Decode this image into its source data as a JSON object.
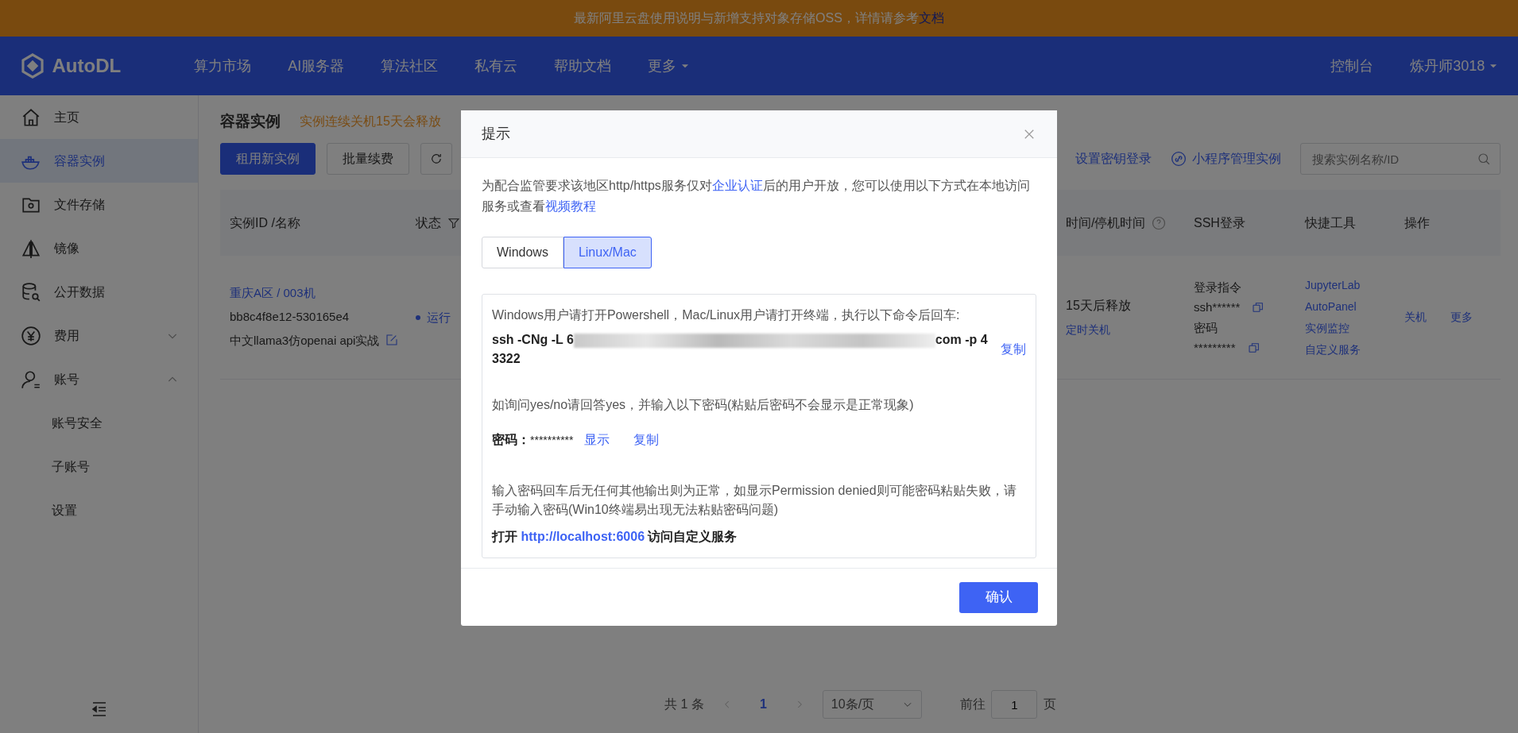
{
  "banner": {
    "text": "最新阿里云盘使用说明与新增支持对象存储OSS，详情请参考",
    "link": "文档"
  },
  "navbar": {
    "brand": "AutoDL",
    "items": [
      {
        "label": "算力市场",
        "kind": "link"
      },
      {
        "label": "AI服务器",
        "kind": "link"
      },
      {
        "label": "算法社区",
        "kind": "link"
      },
      {
        "label": "私有云",
        "kind": "link"
      },
      {
        "label": "帮助文档",
        "kind": "link"
      },
      {
        "label": "更多",
        "kind": "dropdown"
      }
    ],
    "right": [
      {
        "label": "控制台",
        "kind": "link"
      },
      {
        "label": "炼丹师3018",
        "kind": "dropdown"
      }
    ]
  },
  "sidebar": {
    "items": [
      {
        "label": "主页",
        "selected": false
      },
      {
        "label": "容器实例",
        "selected": true
      },
      {
        "label": "文件存储",
        "selected": false
      },
      {
        "label": "镜像",
        "selected": false
      },
      {
        "label": "公开数据",
        "selected": false
      },
      {
        "label": "费用",
        "selected": false,
        "expanded": false
      },
      {
        "label": "账号",
        "selected": false,
        "expanded": true,
        "children": [
          {
            "label": "账号安全",
            "selected": false
          },
          {
            "label": "子账号",
            "selected": false
          },
          {
            "label": "设置",
            "selected": false
          }
        ]
      }
    ]
  },
  "page": {
    "title": "容器实例",
    "notice": "实例连续关机15天会释放"
  },
  "toolbar": {
    "buttons": [
      {
        "label": "租用新实例",
        "kind": "primary"
      },
      {
        "label": "批量续费",
        "kind": "default"
      },
      {
        "kind": "refresh"
      }
    ],
    "links": [
      {
        "label": "设置密钥登录",
        "kind": "plain"
      },
      {
        "label": "小程序管理实例",
        "kind": "icon"
      }
    ],
    "search": {
      "placeholder": "搜索实例名称/ID"
    }
  },
  "table": {
    "columns": [
      {
        "label": "实例ID /名称",
        "kind": "plain"
      },
      {
        "label": "状态",
        "kind": "filter"
      },
      {
        "label": "时间/停机时间",
        "kind": "help"
      },
      {
        "label": "SSH登录",
        "kind": "plain"
      },
      {
        "label": "快捷工具",
        "kind": "plain"
      },
      {
        "label": "操作",
        "kind": "plain"
      }
    ],
    "rows": [
      {
        "region": "重庆A区 / 003机",
        "id": "bb8c4f8e12-530165e4",
        "name": "中文llama3仿openai api实战",
        "status": "运行",
        "release": "15天后释放",
        "timer": "定时关机",
        "ssh": {
          "command_label": "登录指令",
          "command": "ssh******",
          "password_label": "密码",
          "password": "*********"
        },
        "tools": [
          "JupyterLab",
          "AutoPanel",
          "实例监控",
          "自定义服务"
        ],
        "actions": [
          "关机",
          "更多"
        ]
      }
    ]
  },
  "pagination": {
    "total": "共 1 条",
    "pages": [
      {
        "label": "1",
        "selected": true
      }
    ],
    "page_size": "10条/页",
    "goto_label": "前往",
    "goto_value": "1",
    "page_unit": "页"
  },
  "dialog": {
    "title": "提示",
    "intro": [
      {
        "kind": "text",
        "text": "为配合监管要求该地区http/https服务仅对"
      },
      {
        "kind": "link",
        "text": "企业认证"
      },
      {
        "kind": "text",
        "text": "后的用户开放，您可以使用以下方式在本地访问服务或查看"
      },
      {
        "kind": "link",
        "text": "视频教程"
      }
    ],
    "tabs": [
      {
        "label": "Windows",
        "selected": false
      },
      {
        "label": "Linux/Mac",
        "selected": true
      }
    ],
    "instruction": "Windows用户请打开Powershell，Mac/Linux用户请打开终端，执行以下命令后回车:",
    "command": {
      "prefix": "ssh -CNg -L 6",
      "suffix": "com -p 43322",
      "copy": "复制"
    },
    "hint": "如询问yes/no请回答yes，并输入以下密码(粘贴后密码不会显示是正常现象)",
    "password": {
      "label": "密码：",
      "value": "**********",
      "show": "显示",
      "copy": "复制"
    },
    "note": "输入密码回车后无任何其他输出则为正常，如显示Permission denied则可能密码粘贴失败，请手动输入密码(Win10终端易出现无法粘贴密码问题)",
    "open_line": [
      {
        "kind": "text",
        "text": "打开"
      },
      {
        "kind": "link",
        "text": "http://localhost:6006"
      },
      {
        "kind": "text",
        "text": "访问自定义服务"
      }
    ],
    "confirm": "确认"
  }
}
